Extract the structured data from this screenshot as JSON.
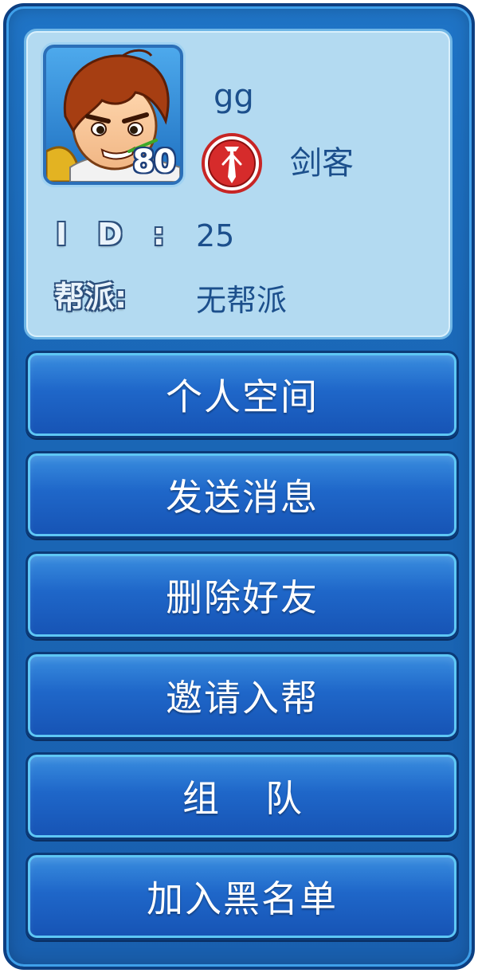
{
  "profile": {
    "name": "gg",
    "level": "80",
    "class_name": "剑客",
    "class_icon": "sword-class-icon",
    "id_label": "ID:",
    "id_value": "25",
    "guild_label": "帮派:",
    "guild_value": "无帮派"
  },
  "menu": [
    {
      "label": "个人空间"
    },
    {
      "label": "发送消息"
    },
    {
      "label": "删除好友"
    },
    {
      "label": "邀请入帮"
    },
    {
      "label": "组队"
    },
    {
      "label": "加入黑名单"
    }
  ],
  "colors": {
    "panel": "#1a67b6",
    "card": "#b3daf1",
    "button": "#1f67c9",
    "button_glow": "#5ec7f5",
    "text_dark": "#1c4f8c",
    "class_icon": "#d22b2b"
  }
}
